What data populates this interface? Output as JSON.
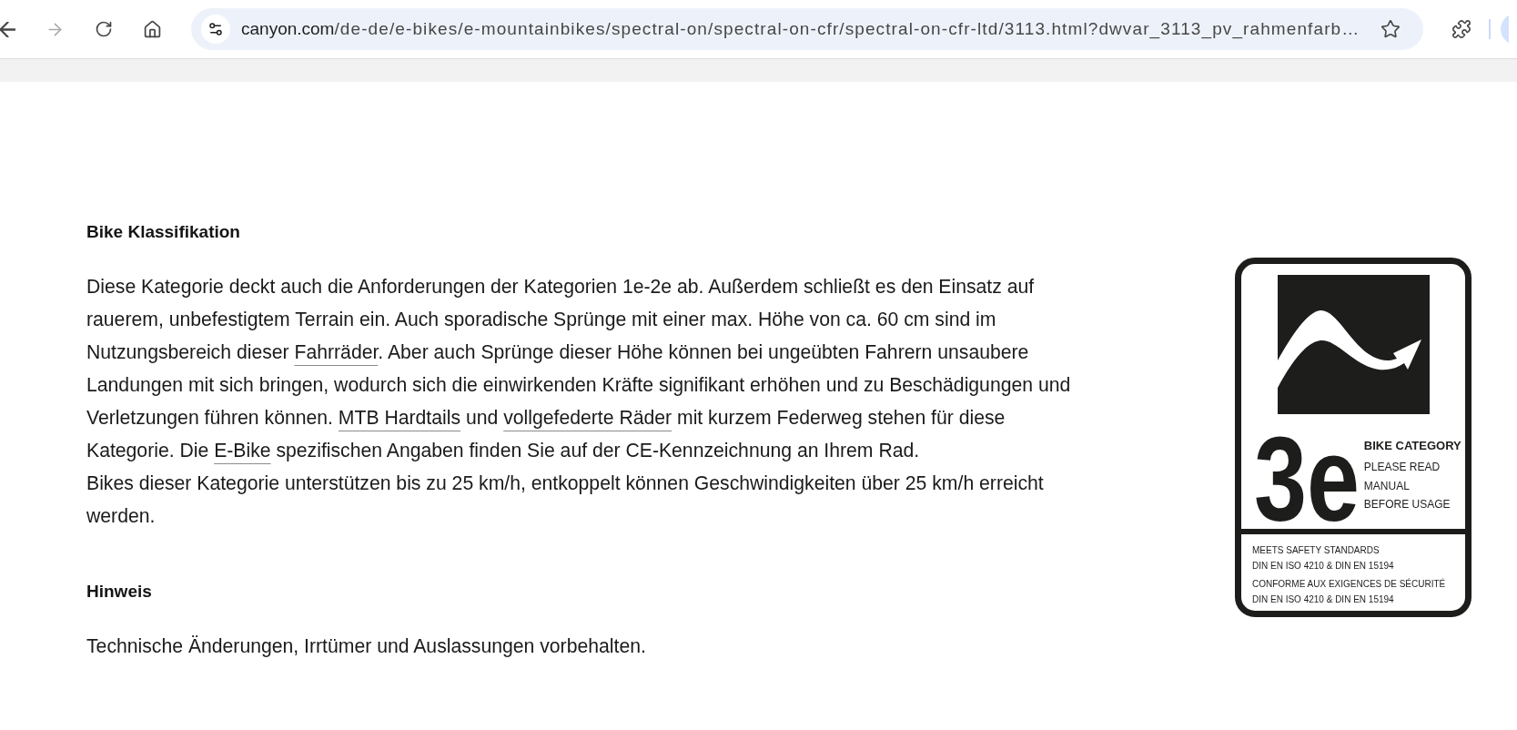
{
  "browser": {
    "nav_buttons": [
      {
        "kind": "back",
        "disabled": false
      },
      {
        "kind": "forward",
        "disabled": true
      },
      {
        "kind": "reload",
        "disabled": false
      },
      {
        "kind": "home",
        "disabled": false
      }
    ],
    "address_bar": {
      "host": "canyon.com",
      "path": "/de-de/e-bikes/e-mountainbikes/spectral-on/spectral-on-cfr/spectral-on-cfr-ltd/3113.html?dwvar_3113_pv_rahmenfarb…",
      "bookmarked": false
    }
  },
  "sections": [
    {
      "heading": "Bike Klassifikation",
      "paragraphs": [
        [
          {
            "kind": "text",
            "text": "Diese Kategorie deckt auch die Anforderungen der Kategorien 1e-2e ab. Außerdem schließt es den Einsatz auf rauerem, unbefestigtem Terrain ein. Auch sporadische Sprünge mit einer max. Höhe von ca. 60 cm sind im Nutzungsbereich dieser "
          },
          {
            "kind": "link",
            "text": "Fahrräder"
          },
          {
            "kind": "text",
            "text": ". Aber auch Sprünge dieser Höhe können bei ungeübten Fahrern unsaubere Landungen mit sich bringen, wodurch sich die einwirkenden Kräfte signifikant erhöhen und zu Beschädigungen und Verletzungen führen können. "
          },
          {
            "kind": "link",
            "text": "MTB Hardtails"
          },
          {
            "kind": "text",
            "text": " und "
          },
          {
            "kind": "link",
            "text": "vollgefederte Räder"
          },
          {
            "kind": "text",
            "text": " mit kurzem Federweg stehen für diese Kategorie. Die "
          },
          {
            "kind": "link",
            "text": "E-Bike"
          },
          {
            "kind": "text",
            "text": " spezifischen Angaben finden Sie auf der CE-Kennzeichnung an Ihrem Rad."
          }
        ],
        [
          {
            "kind": "text",
            "text": "Bikes dieser Kategorie unterstützen bis zu 25 km/h, entkoppelt können Geschwindigkeiten über 25 km/h erreicht werden."
          }
        ]
      ]
    },
    {
      "heading": "Hinweis",
      "paragraphs": [
        [
          {
            "kind": "text",
            "text": "Technische Änderungen, Irrtümer und Auslassungen vorbehalten."
          }
        ]
      ]
    }
  ],
  "category_sign": {
    "number": "3e",
    "title": "BIKE CATEGORY",
    "notice": [
      "PLEASE READ",
      "MANUAL",
      "BEFORE USAGE"
    ],
    "standards": [
      [
        "MEETS SAFETY STANDARDS",
        "DIN EN ISO 4210 & DIN EN 15194"
      ],
      [
        "CONFORME AUX EXIGENCES DE SÉCURITÉ",
        "DIN EN ISO 4210 & DIN EN 15194"
      ]
    ]
  }
}
